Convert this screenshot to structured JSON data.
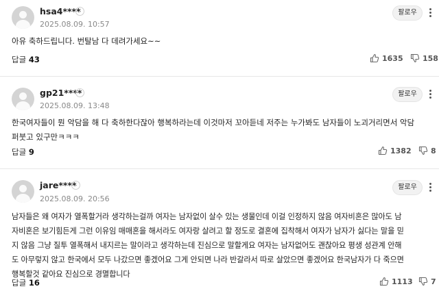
{
  "comments": [
    {
      "username": "hsa4****",
      "date": "2025.08.09. 10:57",
      "follow_label": "팔로우",
      "content": "아유 축하드립니다. 번탈남 다 데려가세요~~",
      "reply_label": "답글",
      "reply_count": "43",
      "likes": "1635",
      "dislikes": "158"
    },
    {
      "username": "gp21****",
      "date": "2025.08.09. 13:48",
      "follow_label": "팔로우",
      "content_lines": [
        "한국여자들이 뭔 악담을 해 다 축하한다잖아 행복하라는데 이것마저 꼬아듣네 저주는 누가봐도 남자들이 노괴거리면서 악담",
        "퍼붓고 있구만ㅋㅋㅋ"
      ],
      "reply_label": "답글",
      "reply_count": "9",
      "likes": "1382",
      "dislikes": "8"
    },
    {
      "username": "jare****",
      "date": "2025.08.09. 20:56",
      "follow_label": "팔로우",
      "content_lines": [
        "남자들은 왜 여자가 열폭할거라 생각하는걸까 여자는 남자없이 살수 있는 생물인데 이걸 인정하지 않음 여자비혼은 많아도 남",
        "자비혼은 보기힘든게 그런 이유임 매매혼을 해서라도 여자랑 살려고 할 정도로 결혼에 집착해서 여자가 남자가 싫다는 말을 믿",
        "지 않음 그냥 질투 열폭해서 내지르는 말이라고 생각하는데 진심으로 말할게요 여자는 남자없어도 괜찮아요 평생 성관계 안해",
        "도 아무렇지 않고 한국에서 모두 나갔으면 좋겠어요 그게 안되면 나라 반갈라서 따로 살았으면 좋겠어요 한국남자가 다 죽으면",
        "행복할것 같아요 진심으로 경멸합니다"
      ],
      "reply_label": "답글",
      "reply_count": "16",
      "likes": "1113",
      "dislikes": "7"
    }
  ],
  "icons": {
    "chevron": "chevron-right-icon",
    "like": "thumbs-up-icon",
    "dislike": "thumbs-down-icon",
    "more": "more-vertical-icon"
  }
}
